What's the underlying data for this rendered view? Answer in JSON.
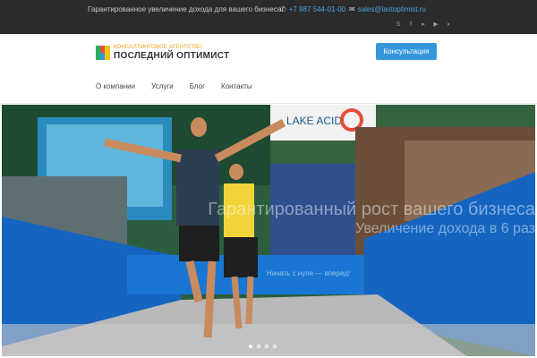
{
  "topbar": {
    "tagline": "Гарантированное увеличение дохода для вашего бизнеса.",
    "phone": "+7 987 544-01-00",
    "email": "sales@lastoptimist.ru",
    "socials": [
      "skype-icon",
      "facebook-icon",
      "vimeo-icon",
      "youtube-icon",
      "rss-icon"
    ]
  },
  "header": {
    "logo_sub": "КОНСАЛТИНГОВОЕ АГЕНТСТВО",
    "logo_main": "ПОСЛЕДНИЙ ОПТИМИСТ",
    "cta_label": "Консультация"
  },
  "nav": {
    "items": [
      "О компании",
      "Услуги",
      "Блог",
      "Контакты"
    ]
  },
  "hero": {
    "line1": "Гарантированный рост вашего бизнеса",
    "line2": "Увеличение дохода в 6 раз",
    "line3": "Начать с нуля — вперед!",
    "banner_text": "LAKE ACID",
    "slides_total": 4,
    "slide_active": 1
  },
  "colors": {
    "accent": "#3498db",
    "topbar_bg": "#2b2b2b",
    "logo_orange": "#f39c12"
  }
}
